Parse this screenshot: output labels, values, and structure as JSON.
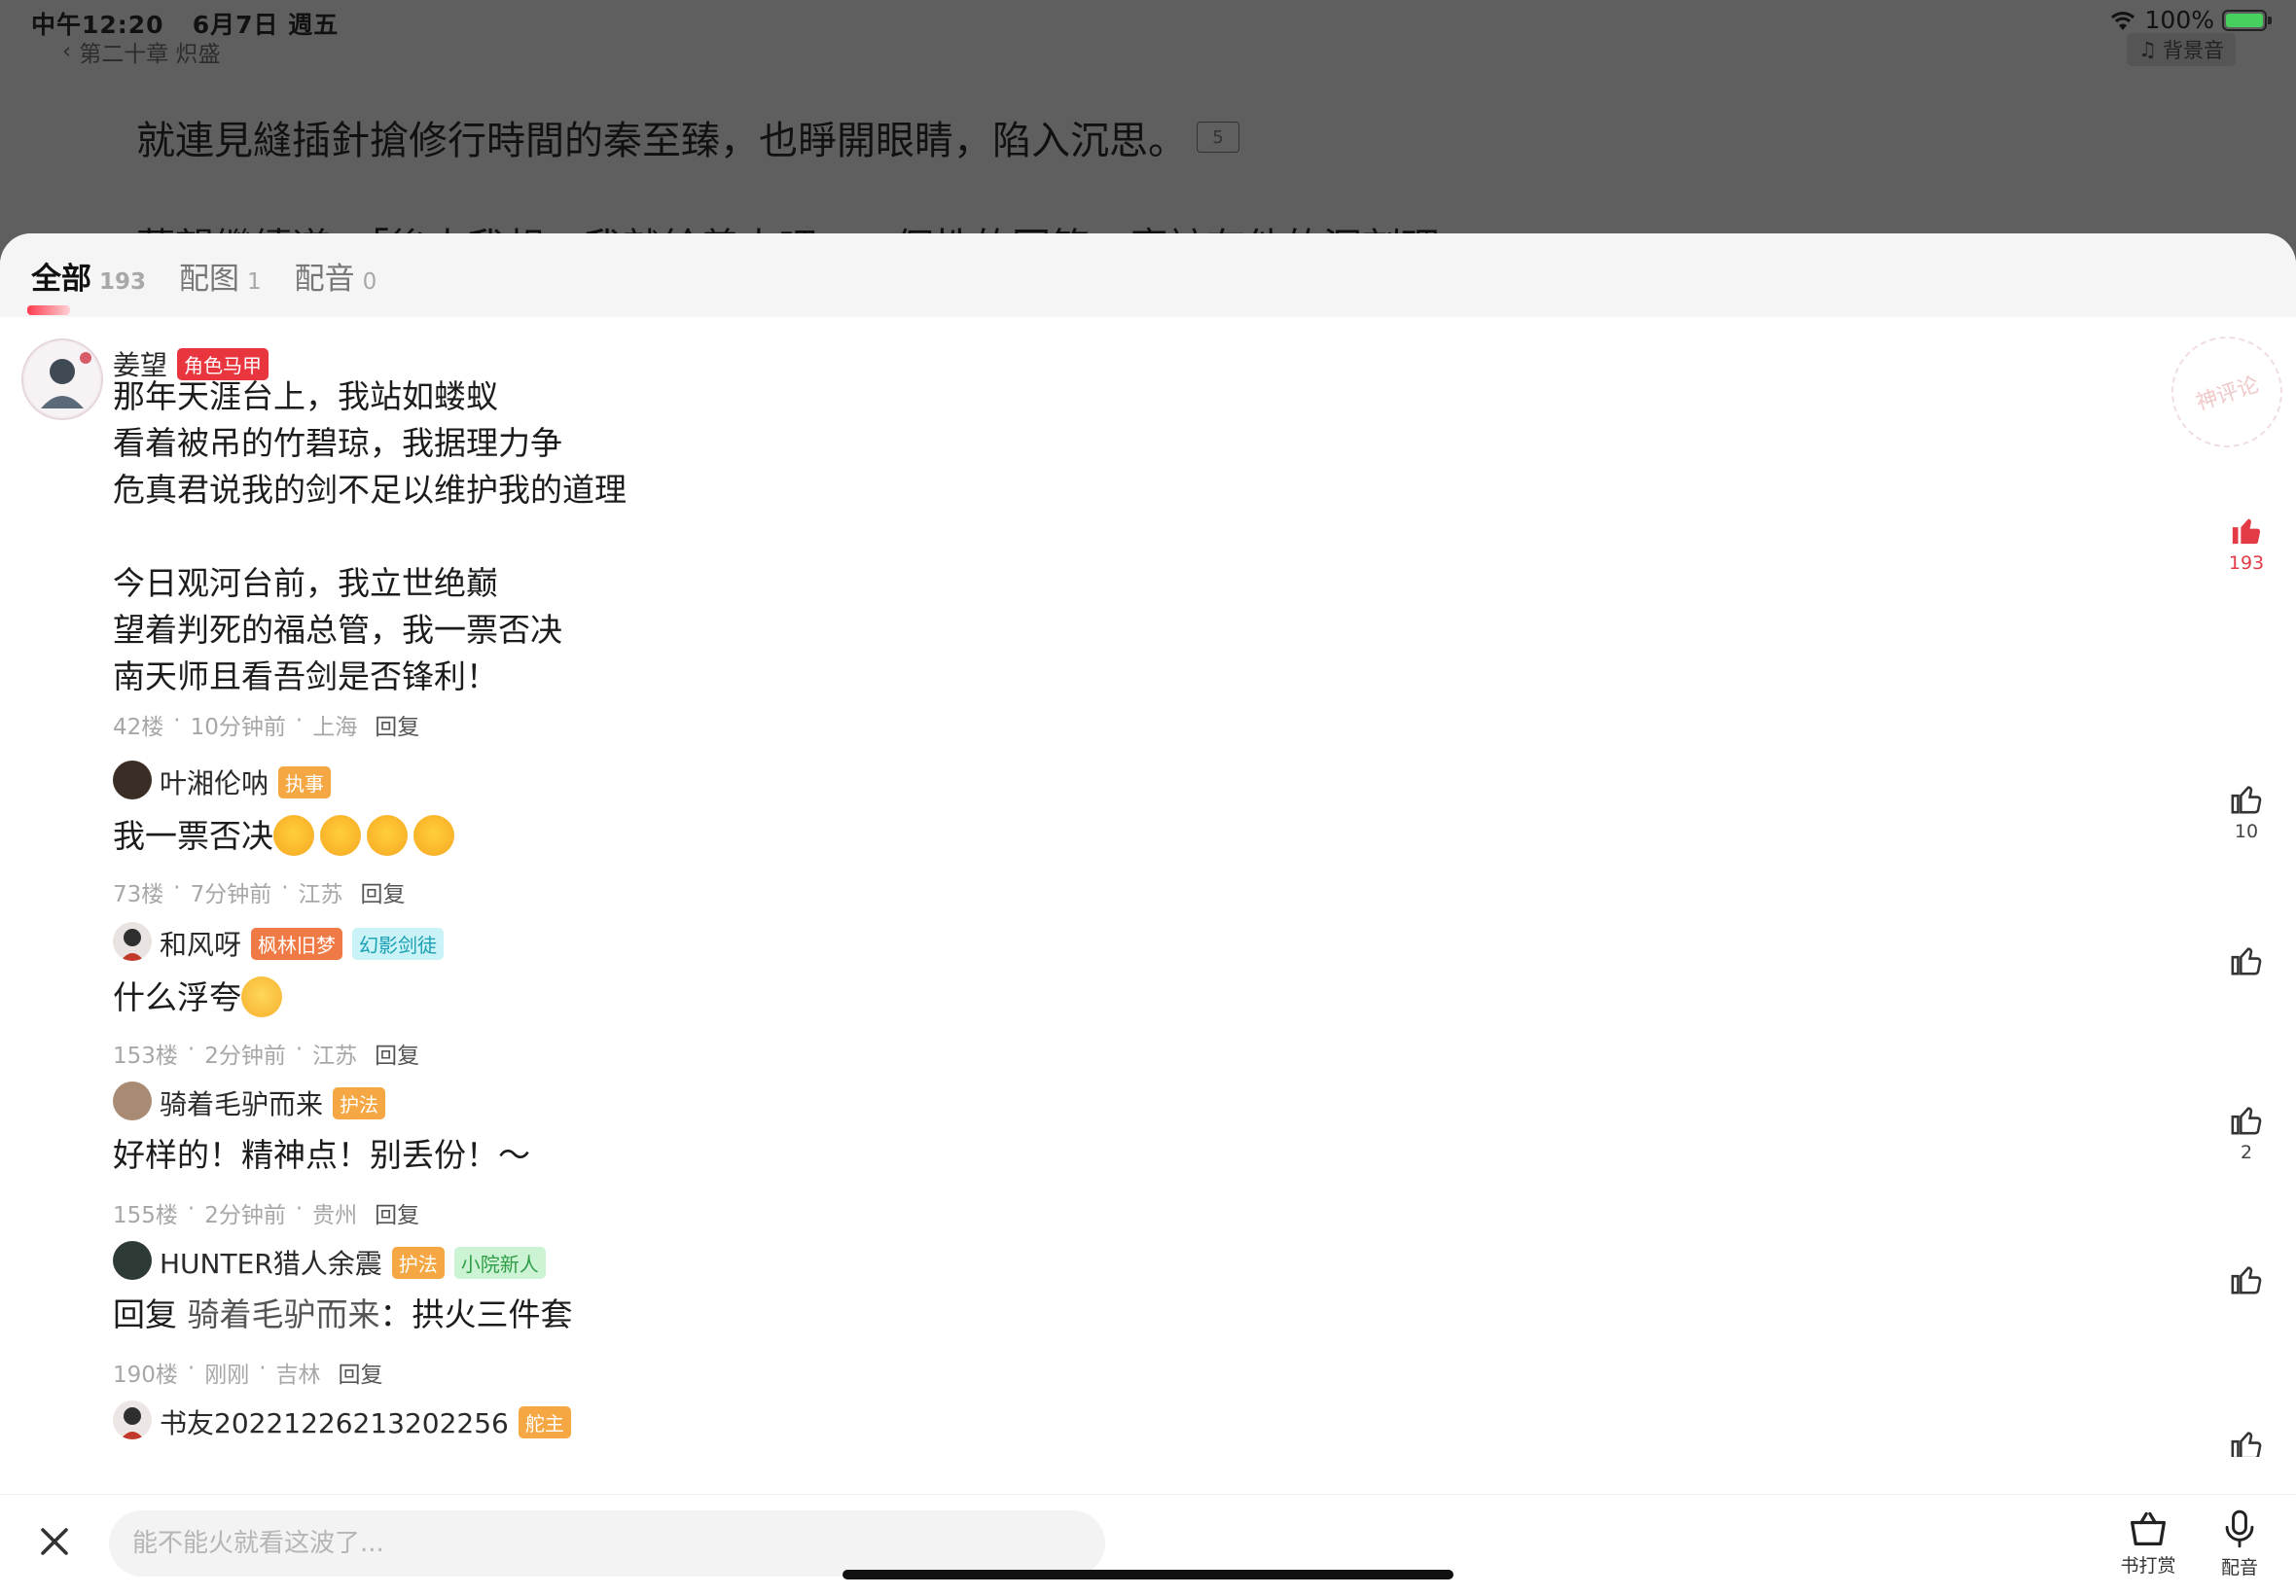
{
  "status": {
    "time": "中午12:20",
    "date": "6月7日 週五",
    "battery": "100%",
    "battery_fraction": 1.0
  },
  "reader": {
    "chapter": "第二十章 炽盛",
    "bgm_label": "背景音",
    "line1": "就連見縫插針搶修行時間的秦至臻，也睜開眼睛，陷入沉思。",
    "line1_comment_count": "5",
    "line2": "薑望繼續道：「後來我想，我就給善來吧……個性的回答，應該有他的深刻理"
  },
  "tabs": [
    {
      "label": "全部",
      "count": "193"
    },
    {
      "label": "配图",
      "count": "1"
    },
    {
      "label": "配音",
      "count": "0"
    }
  ],
  "stamp_label": "神评论",
  "comments": [
    {
      "user": "姜望",
      "badges": [
        "角色马甲"
      ],
      "body": "那年天涯台上，我站如蝼蚁\n看着被吊的竹碧琼，我据理力争\n危真君说我的剑不足以维护我的道理\n\n今日观河台前，我立世绝巅\n望着判死的福总管，我一票否决\n南天师且看吾剑是否锋利！",
      "floor": "42楼",
      "time": "10分钟前",
      "location": "上海",
      "reply_label": "回复",
      "likes": "193"
    },
    {
      "user": "叶湘伦呐",
      "badges": [
        "执事"
      ],
      "body": "我一票否决",
      "emoji": "heart-eyes",
      "emoji_count": 4,
      "floor": "73楼",
      "time": "7分钟前",
      "location": "江苏",
      "reply_label": "回复",
      "likes": "10"
    },
    {
      "user": "和风呀",
      "badges": [
        "枫林旧梦",
        "幻影剑徒"
      ],
      "body": "什么浮夸",
      "emoji": "smirk",
      "emoji_count": 1,
      "floor": "153楼",
      "time": "2分钟前",
      "location": "江苏",
      "reply_label": "回复",
      "likes": ""
    },
    {
      "user": "骑着毛驴而来",
      "badges": [
        "护法"
      ],
      "body": "好样的！精神点！别丢份！～",
      "floor": "155楼",
      "time": "2分钟前",
      "location": "贵州",
      "reply_label": "回复",
      "likes": "2"
    },
    {
      "user": "HUNTER猎人余震",
      "badges": [
        "护法",
        "小院新人"
      ],
      "reply_prefix": "回复",
      "reply_to": "骑着毛驴而来",
      "body": "：拱火三件套",
      "floor": "190楼",
      "time": "刚刚",
      "location": "吉林",
      "reply_label": "回复",
      "likes": ""
    },
    {
      "user": "书友20221226213202256",
      "badges": [
        "舵主"
      ]
    }
  ],
  "input": {
    "placeholder": "能不能火就看这波了..."
  },
  "actions": {
    "tip_label": "书打赏",
    "voice_label": "配音"
  },
  "colors": {
    "accent": "#e8353e",
    "badge_orange": "#f4a742",
    "sheet_tab_bg": "#f5f5f5"
  }
}
